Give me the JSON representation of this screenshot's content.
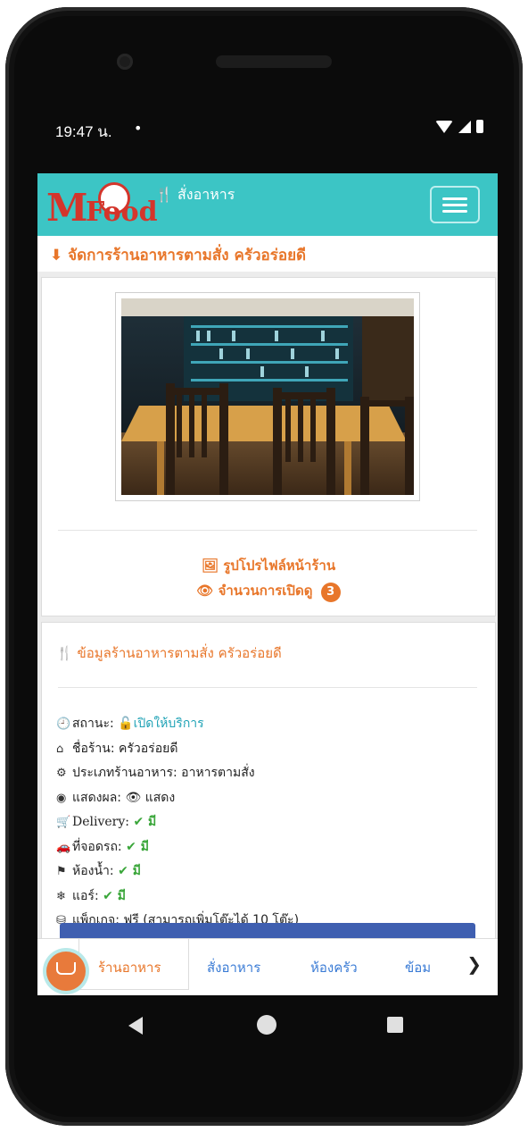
{
  "status_bar": {
    "time": "19:47 น.",
    "dot": "•"
  },
  "app": {
    "logo": {
      "m": "M",
      "food": "Food"
    },
    "nav_title": "สั่งอาหาร"
  },
  "page_heading": "จัดการร้านอาหารตามสั่ง ครัวอร่อยดี",
  "profile_card": {
    "profile_link": "รูปโปรไฟล์หน้าร้าน",
    "views_label": "จำนวนการเปิดดู",
    "views_count": "3"
  },
  "info_card": {
    "title": "ข้อมูลร้านอาหารตามสั่ง ครัวอร่อยดี",
    "rows": [
      {
        "icon": "clock-icon",
        "label": "สถานะ: ",
        "value": "เปิดให้บริการ"
      },
      {
        "icon": "home-icon",
        "label": "ชื่อร้าน: ",
        "value": "ครัวอร่อยดี"
      },
      {
        "icon": "gears-icon",
        "label": "ประเภทร้านอาหาร: ",
        "value": "อาหารตามสั่ง"
      },
      {
        "icon": "target-icon",
        "label": "แสดงผล: ",
        "value": "แสดง"
      },
      {
        "icon": "cart-icon",
        "label": "Delivery: ",
        "value": "มี"
      },
      {
        "icon": "car-icon",
        "label": "ที่จอดรถ: ",
        "value": "มี"
      },
      {
        "icon": "toilet-icon",
        "label": "ห้องน้ำ: ",
        "value": "มี"
      },
      {
        "icon": "snowflake-icon",
        "label": "แอร์: ",
        "value": "มี"
      },
      {
        "icon": "package-icon",
        "label": "แพ็กเกจ: ",
        "value": "ฟรี (สามารถเพิ่มโต๊ะได้ 10 โต๊ะ)"
      }
    ]
  },
  "bottom_nav": {
    "tabs": [
      "ร้านอาหาร",
      "สั่งอาหาร",
      "ห้องครัว",
      "ข้อม"
    ],
    "active_tab": "ร้านอาหาร",
    "more": "❯"
  },
  "colors": {
    "accent": "#e8762a",
    "navbar": "#3cc5c5",
    "link": "#20a3b6",
    "check": "#3aa63a"
  }
}
